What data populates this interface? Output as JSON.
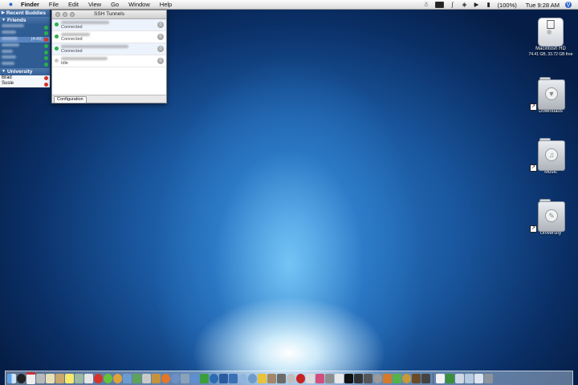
{
  "menubar": {
    "app": "Finder",
    "items": [
      "File",
      "Edit",
      "View",
      "Go",
      "Window",
      "Help"
    ],
    "battery": "(100%)",
    "clock": "Tue 9:28 AM"
  },
  "buddy_list": {
    "groups": [
      {
        "name": "Recent Buddies",
        "collapsed": true
      },
      {
        "name": "Friends",
        "collapsed": false
      },
      {
        "name": "University",
        "collapsed": false
      }
    ],
    "friend_idle": "(4:49)",
    "university_buddies": [
      "Brad",
      "Susie"
    ]
  },
  "ssh_window": {
    "title": "SSH Tunnels",
    "tunnels": [
      {
        "state": "Connected",
        "button": "0"
      },
      {
        "state": "Connected",
        "button": "0"
      },
      {
        "state": "Connected",
        "button": "0"
      },
      {
        "state": "Idle",
        "button": "0"
      }
    ],
    "config_button": "Configuration"
  },
  "desktop": {
    "hd_name": "Macintosh HD",
    "hd_info": "74.41 GB, 33.72 GB free",
    "folders": [
      "Downloads",
      "Music",
      "University"
    ]
  }
}
